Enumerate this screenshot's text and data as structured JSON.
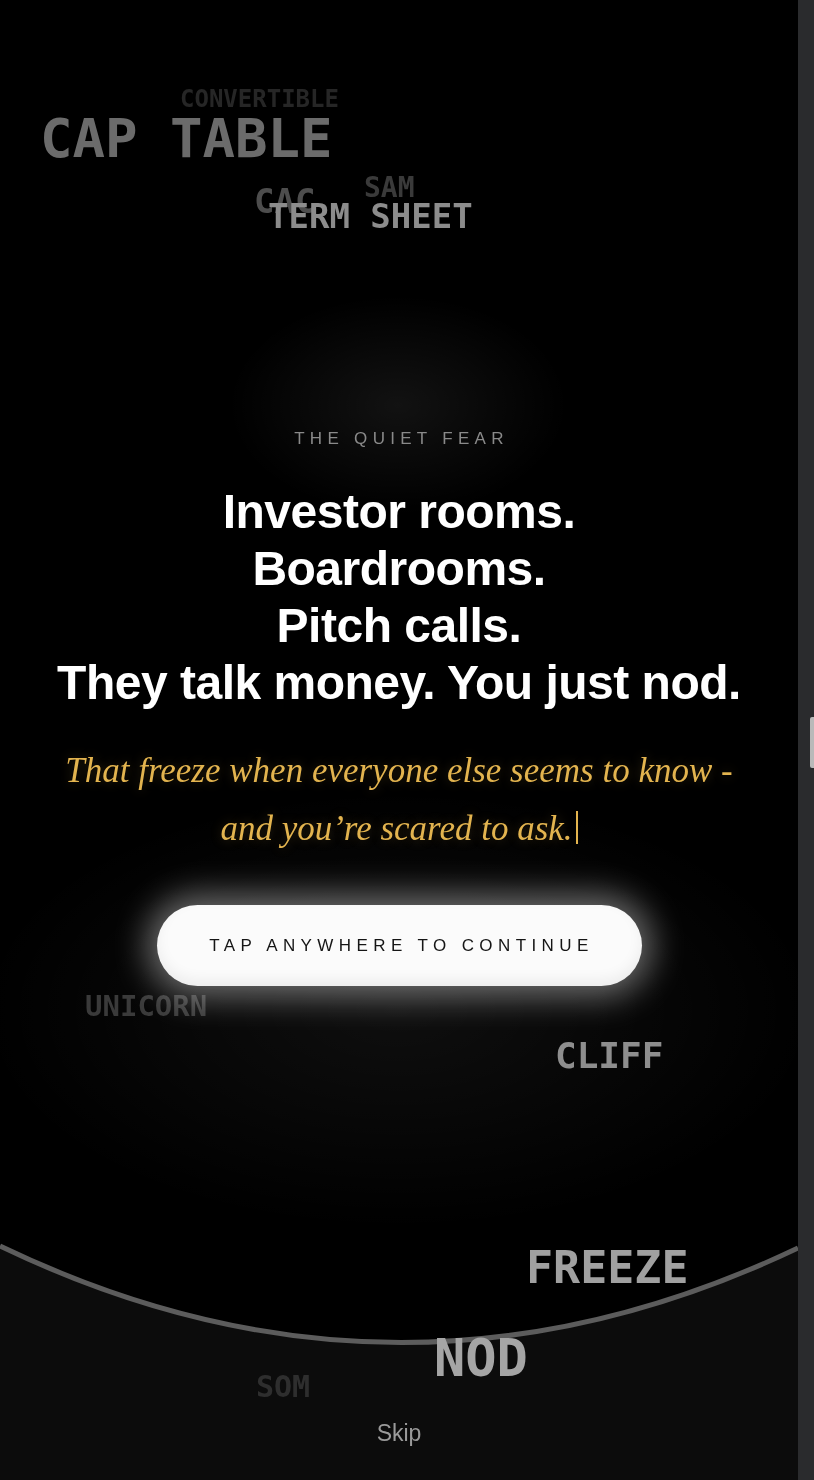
{
  "floating_words": [
    "CONVERTIBLE",
    "CAP TABLE",
    "SAM",
    "CAC",
    "TERM SHEET",
    "UNICORN",
    "CLIFF",
    "FREEZE",
    "NOD",
    "SOM"
  ],
  "eyebrow": "THE QUIET FEAR",
  "headline": [
    "Investor rooms.",
    "Boardrooms.",
    "Pitch calls.",
    "They talk money. You just nod."
  ],
  "subtext": {
    "text": "That freeze when everyone else seems to know - and you’re scared to ask.",
    "typing_cursor": true
  },
  "button": {
    "label": "TAP ANYWHERE TO CONTINUE"
  },
  "skip": "Skip"
}
